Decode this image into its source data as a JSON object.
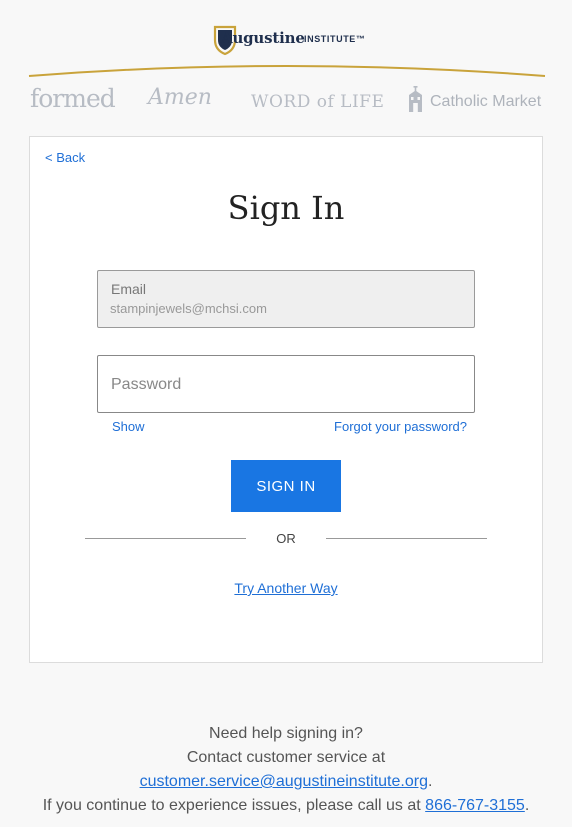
{
  "header": {
    "logo_name": "Augustine",
    "logo_sub": "INSTITUTE™",
    "brands": [
      "formed",
      "Amen",
      "WORD of LIFE",
      "Catholic Market"
    ],
    "accent_gold": "#c9a33b",
    "navy": "#1f2f4d"
  },
  "card": {
    "back_label": "< Back",
    "title": "Sign In",
    "email_label": "Email",
    "email_value": "stampinjewels@mchsi.com",
    "password_placeholder": "Password",
    "show_label": "Show",
    "forgot_label": "Forgot your password?",
    "signin_label": "SIGN IN",
    "or_label": "OR",
    "try_label": "Try Another Way",
    "primary_color": "#1976e3"
  },
  "help": {
    "line1": "Need help signing in?",
    "line2": "Contact customer service at",
    "email": "customer.service@augustineinstitute.org",
    "line3_prefix": "If you continue to experience issues, please call us at",
    "phone": "866-767-3155",
    "period": "."
  }
}
